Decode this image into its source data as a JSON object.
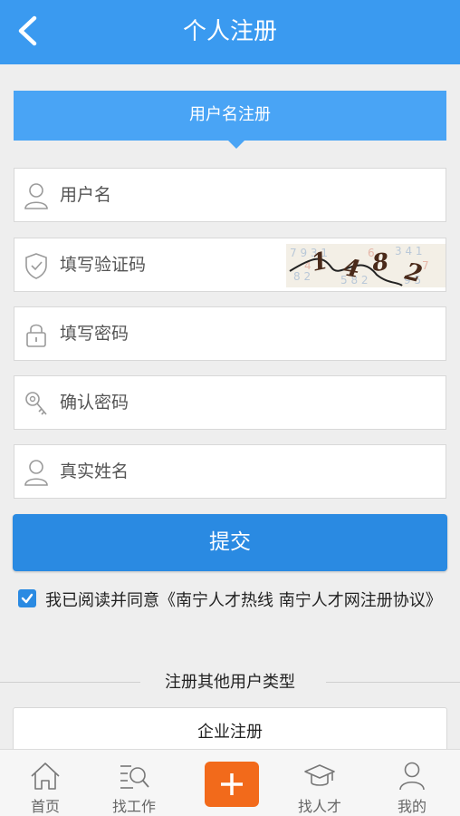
{
  "header": {
    "title": "个人注册"
  },
  "tab": {
    "label": "用户名注册"
  },
  "form": {
    "username_placeholder": "用户名",
    "captcha_placeholder": "填写验证码",
    "captcha_text": "1482",
    "password_placeholder": "填写密码",
    "confirm_placeholder": "确认密码",
    "realname_placeholder": "真实姓名",
    "submit_label": "提交"
  },
  "agreement": {
    "checked": true,
    "text": "我已阅读并同意《南宁人才热线 南宁人才网注册协议》"
  },
  "other": {
    "divider_label": "注册其他用户类型",
    "company_label": "企业注册"
  },
  "bottom_nav": [
    {
      "label": "首页",
      "icon": "home-icon"
    },
    {
      "label": "找工作",
      "icon": "search-job-icon"
    },
    {
      "label": "",
      "icon": "plus-icon"
    },
    {
      "label": "找人才",
      "icon": "graduation-cap-icon"
    },
    {
      "label": "我的",
      "icon": "user-icon"
    }
  ],
  "colors": {
    "header": "#3a9af0",
    "tab": "#49a4f5",
    "submit": "#2a8ae2",
    "plus": "#f26a1b"
  }
}
